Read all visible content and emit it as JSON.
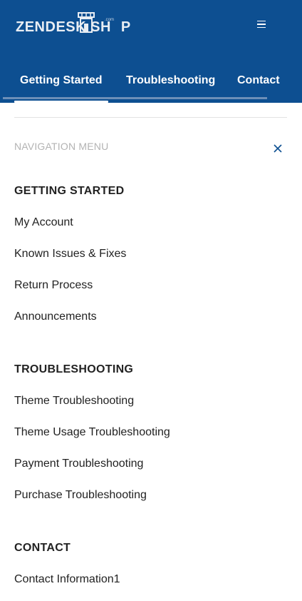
{
  "header": {
    "logo_text": "ZENDESK SH",
    "logo_text_end": "P",
    "logo_com": ".com",
    "menu_icon": "hamburger-menu-icon",
    "background_color": "#0d4f91"
  },
  "tabs": [
    {
      "label": "Getting Started"
    },
    {
      "label": "Troubleshooting"
    },
    {
      "label": "Contact"
    }
  ],
  "nav": {
    "title": "NAVIGATION MENU",
    "close_icon": "close-icon",
    "sections": [
      {
        "title": "GETTING STARTED",
        "links": [
          "My Account",
          "Known Issues & Fixes",
          "Return Process",
          "Announcements"
        ]
      },
      {
        "title": "TROUBLESHOOTING",
        "links": [
          "Theme Troubleshooting",
          "Theme Usage Troubleshooting",
          "Payment Troubleshooting",
          "Purchase Troubleshooting"
        ]
      },
      {
        "title": "CONTACT",
        "links": [
          "Contact Information1"
        ]
      }
    ]
  }
}
